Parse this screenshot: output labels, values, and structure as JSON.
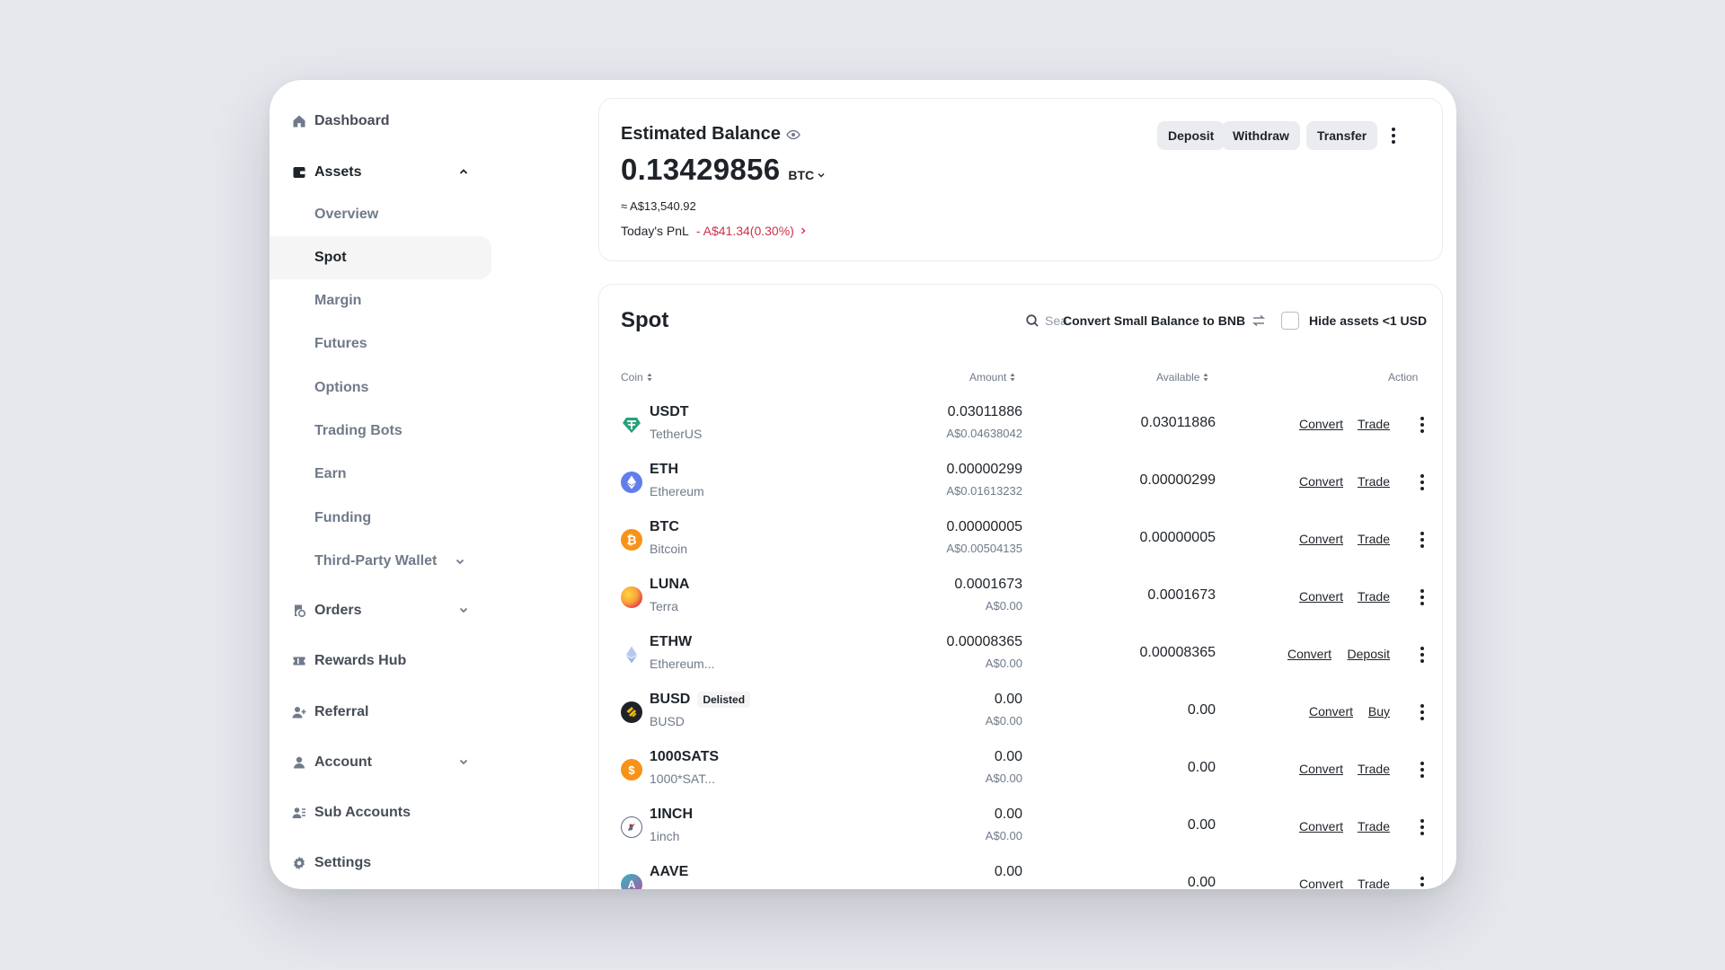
{
  "sidebar": {
    "dashboard": "Dashboard",
    "assets": "Assets",
    "assets_sub": [
      "Overview",
      "Spot",
      "Margin",
      "Futures",
      "Options",
      "Trading Bots",
      "Earn",
      "Funding",
      "Third-Party Wallet"
    ],
    "orders": "Orders",
    "rewards_hub": "Rewards Hub",
    "referral": "Referral",
    "account": "Account",
    "sub_accounts": "Sub Accounts",
    "settings": "Settings"
  },
  "balance": {
    "title": "Estimated Balance",
    "value": "0.13429856",
    "unit": "BTC",
    "fiat": "≈ A$13,540.92",
    "pnl_label": "Today's PnL",
    "pnl_value": "- A$41.34(0.30%)",
    "deposit": "Deposit",
    "withdraw": "Withdraw",
    "transfer": "Transfer"
  },
  "spot": {
    "title": "Spot",
    "search_placeholder": "Sea",
    "convert_small": "Convert Small Balance to BNB",
    "hide_small": "Hide assets <1 USD",
    "headers": {
      "coin": "Coin",
      "amount": "Amount",
      "available": "Available",
      "action": "Action"
    },
    "rows": [
      {
        "symbol": "USDT",
        "name": "TetherUS",
        "amount": "0.03011886",
        "fiat": "A$0.04638042",
        "available": "0.03011886",
        "a1": "Convert",
        "a2": "Trade",
        "icon_color": "#26a17b"
      },
      {
        "symbol": "ETH",
        "name": "Ethereum",
        "amount": "0.00000299",
        "fiat": "A$0.01613232",
        "available": "0.00000299",
        "a1": "Convert",
        "a2": "Trade",
        "icon_color": "#627eea"
      },
      {
        "symbol": "BTC",
        "name": "Bitcoin",
        "amount": "0.00000005",
        "fiat": "A$0.00504135",
        "available": "0.00000005",
        "a1": "Convert",
        "a2": "Trade",
        "icon_color": "#f7931a"
      },
      {
        "symbol": "LUNA",
        "name": "Terra",
        "amount": "0.0001673",
        "fiat": "A$0.00",
        "available": "0.0001673",
        "a1": "Convert",
        "a2": "Trade",
        "icon_color": "#f9b240"
      },
      {
        "symbol": "ETHW",
        "name": "Ethereum...",
        "amount": "0.00008365",
        "fiat": "A$0.00",
        "available": "0.00008365",
        "a1": "Convert",
        "a2": "Deposit",
        "icon_color": "#9fb4e8"
      },
      {
        "symbol": "BUSD",
        "name": "BUSD",
        "badge": "Delisted",
        "amount": "0.00",
        "fiat": "A$0.00",
        "available": "0.00",
        "a1": "Convert",
        "a2": "Buy",
        "icon_color": "#1e2329"
      },
      {
        "symbol": "1000SATS",
        "name": "1000*SAT...",
        "amount": "0.00",
        "fiat": "A$0.00",
        "available": "0.00",
        "a1": "Convert",
        "a2": "Trade",
        "icon_color": "#f7931a"
      },
      {
        "symbol": "1INCH",
        "name": "1inch",
        "amount": "0.00",
        "fiat": "A$0.00",
        "available": "0.00",
        "a1": "Convert",
        "a2": "Trade",
        "icon_color": "#5b6b86"
      },
      {
        "symbol": "AAVE",
        "name": "",
        "amount": "0.00",
        "fiat": "",
        "available": "0.00",
        "a1": "Convert",
        "a2": "Trade",
        "icon_color": "#9b6ab8"
      }
    ]
  },
  "colors": {
    "negative": "#cf304a",
    "text": "#1e2329",
    "muted": "#707a8a"
  }
}
